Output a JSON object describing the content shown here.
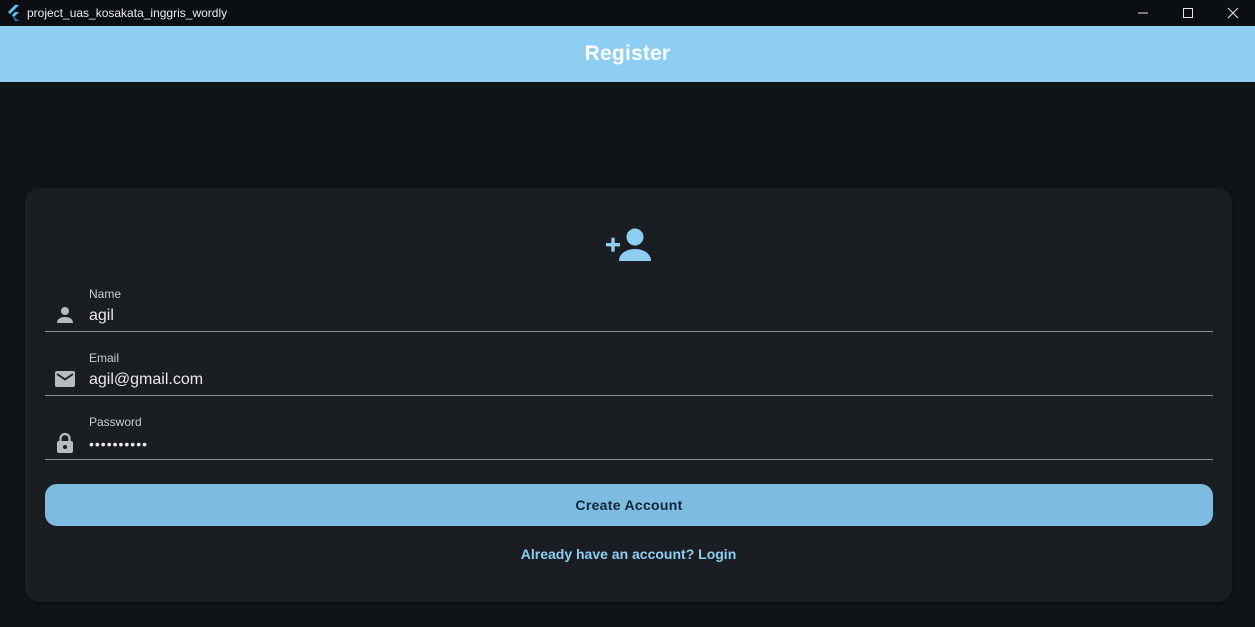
{
  "window": {
    "title": "project_uas_kosakata_inggris_wordly",
    "logo_icon": "flutter-logo",
    "controls": [
      "minimize-icon",
      "maximize-icon",
      "close-icon"
    ]
  },
  "appbar": {
    "title": "Register",
    "color": "#8ecef2"
  },
  "form": {
    "header_icon": "person-add-icon",
    "fields": [
      {
        "label": "Name",
        "value": "agil",
        "icon": "person-icon"
      },
      {
        "label": "Email",
        "value": "agil@gmail.com",
        "icon": "mail-icon"
      },
      {
        "label": "Password",
        "value": "••••••••••",
        "icon": "lock-icon"
      }
    ],
    "submit_label": "Create Account",
    "login_link": "Already have an account? Login"
  },
  "colors": {
    "background": "#101417",
    "card": "#1a1e22",
    "accent": "#8ecef2",
    "button": "#7dbbe1"
  }
}
